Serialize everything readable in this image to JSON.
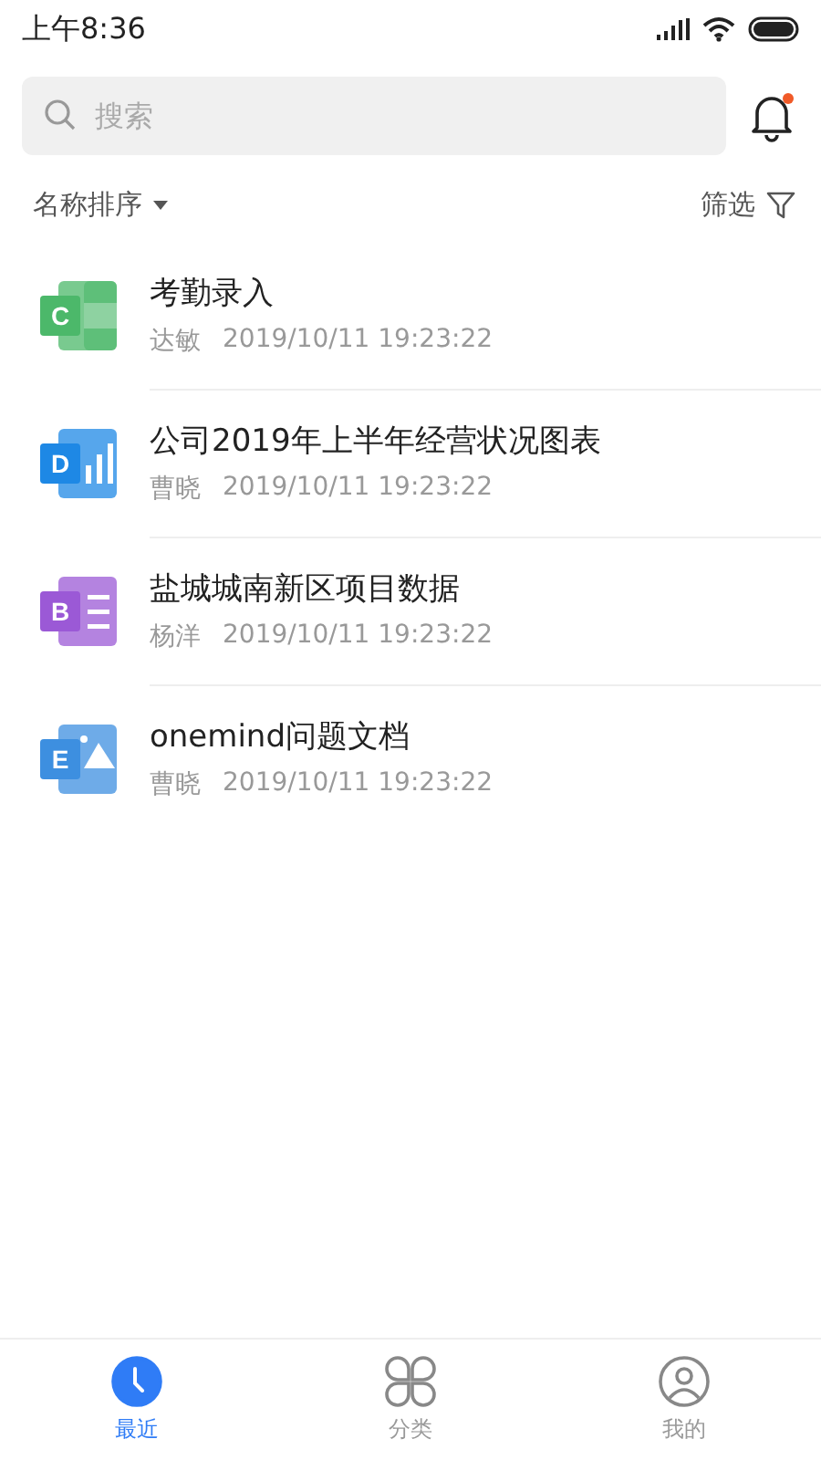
{
  "status_bar": {
    "time": "上午8:36"
  },
  "search": {
    "placeholder": "搜索"
  },
  "notifications": {
    "unread": true
  },
  "sort": {
    "label": "名称排序"
  },
  "filter": {
    "label": "筛选"
  },
  "files": [
    {
      "kind": "sheet",
      "letter": "C",
      "color": "#4cb86a",
      "title": "考勤录入",
      "author": "达敏",
      "time": "2019/10/11 19:23:22"
    },
    {
      "kind": "chart",
      "letter": "D",
      "color": "#1e88e5",
      "title": "公司2019年上半年经营状况图表",
      "author": "曹晓",
      "time": "2019/10/11 19:23:22"
    },
    {
      "kind": "list",
      "letter": "B",
      "color": "#9b59d6",
      "title": "盐城城南新区项目数据",
      "author": "杨洋",
      "time": "2019/10/11 19:23:22"
    },
    {
      "kind": "image",
      "letter": "E",
      "color": "#3d8fe0",
      "title": "onemind问题文档",
      "author": "曹晓",
      "time": "2019/10/11 19:23:22"
    }
  ],
  "nav": [
    {
      "kind": "clock",
      "label": "最近",
      "selected": true
    },
    {
      "kind": "grid",
      "label": "分类",
      "selected": false
    },
    {
      "kind": "person",
      "label": "我的",
      "selected": false
    }
  ]
}
